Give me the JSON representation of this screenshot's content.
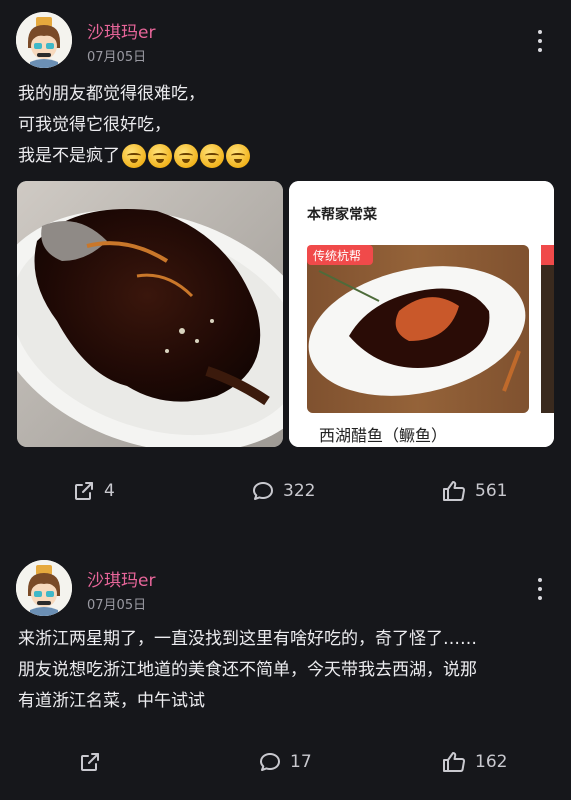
{
  "posts": [
    {
      "username": "沙琪玛er",
      "date": "07月05日",
      "lines": [
        "我的朋友都觉得很难吃，",
        "可我觉得它很好吃，",
        "我是不是疯了"
      ],
      "emoji_icons": [
        "crying-laughing-emoji",
        "crying-laughing-emoji",
        "crying-laughing-emoji",
        "crying-laughing-emoji",
        "crying-laughing-emoji"
      ],
      "images": [
        {
          "kind": "photo",
          "description_icon": "fish-dish-photo"
        },
        {
          "kind": "screenshot",
          "header": "本帮家常菜",
          "tag": "传统杭帮",
          "caption": "西湖醋鱼（鳜鱼）"
        }
      ],
      "stats": {
        "shares": "4",
        "comments": "322",
        "likes": "561"
      }
    },
    {
      "username": "沙琪玛er",
      "date": "07月05日",
      "lines": [
        "来浙江两星期了，一直没找到这里有啥好吃的，奇了怪了……",
        "朋友说想吃浙江地道的美食还不简单，今天带我去西湖，说那",
        "有道浙江名菜，中午试试"
      ],
      "stats": {
        "shares": "",
        "comments": "17",
        "likes": "162"
      }
    }
  ],
  "icons": {
    "share": "share-icon",
    "comment": "comment-icon",
    "like": "thumbs-up-icon",
    "more": "more-vertical-icon"
  },
  "colors": {
    "background": "#16171b",
    "username": "#e8669a",
    "tag": "#f04a4a"
  }
}
